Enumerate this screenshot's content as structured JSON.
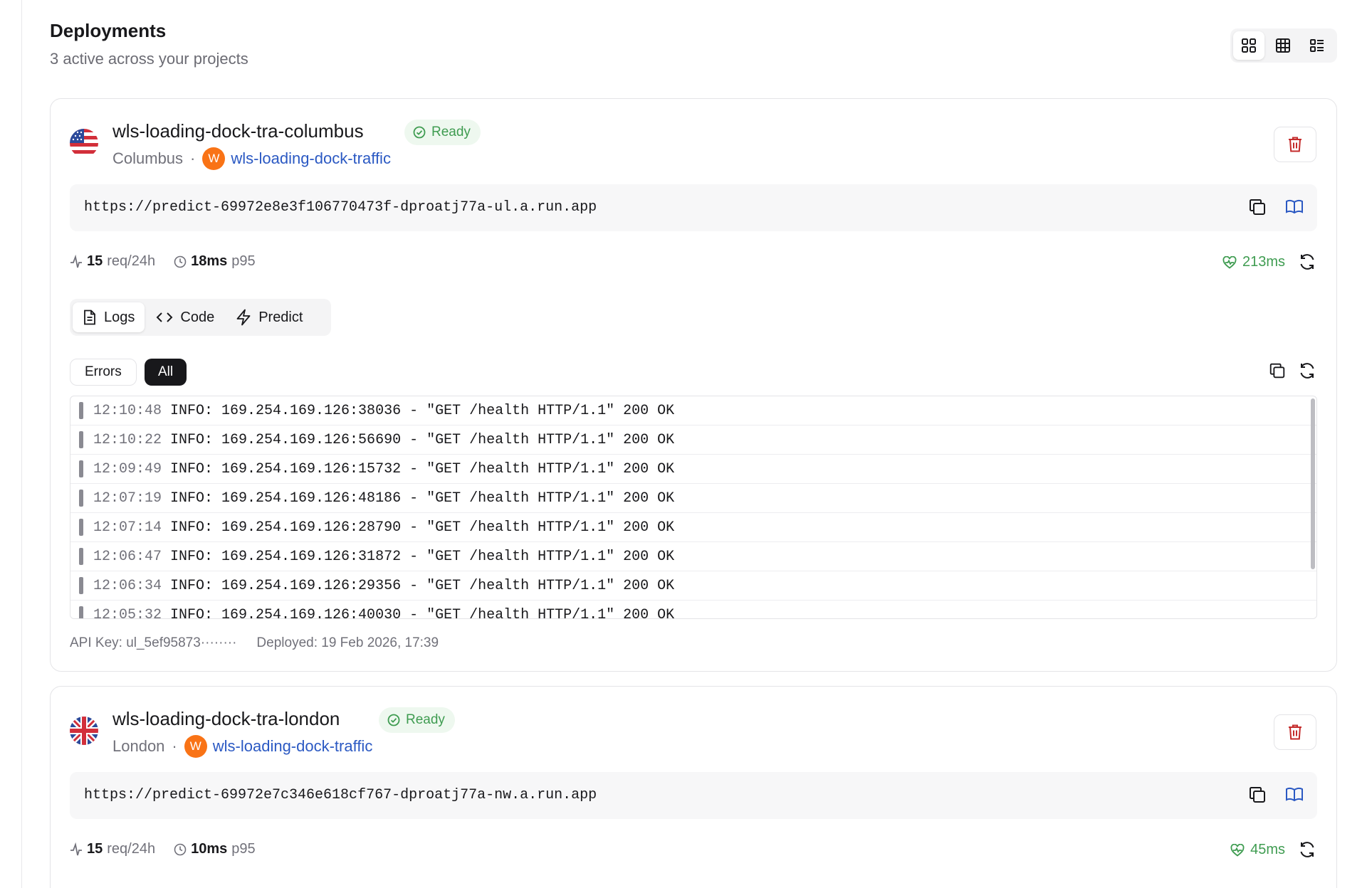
{
  "header": {
    "title": "Deployments",
    "subtitle": "3 active across your projects"
  },
  "view_modes": [
    {
      "icon": "grid-icon",
      "active": true
    },
    {
      "icon": "table-icon",
      "active": false
    },
    {
      "icon": "list-icon",
      "active": false
    }
  ],
  "deployments": [
    {
      "name": "wls-loading-dock-tra-columbus",
      "status": "Ready",
      "flag": "us-flag-icon",
      "location": "Columbus",
      "separator": "·",
      "project_initial": "W",
      "project": "wls-loading-dock-traffic",
      "url": "https://predict-69972e8e3f106770473f-dproatj77a-ul.a.run.app",
      "requests": "15",
      "requests_unit": "req/24h",
      "latency": "18ms",
      "latency_unit": "p95",
      "health": "213ms",
      "tabs": [
        {
          "label": "Logs",
          "icon": "document-icon",
          "active": true
        },
        {
          "label": "Code",
          "icon": "code-icon",
          "active": false
        },
        {
          "label": "Predict",
          "icon": "lightning-icon",
          "active": false
        }
      ],
      "filters": {
        "errors": "Errors",
        "all": "All",
        "selected": "All"
      },
      "logs": [
        {
          "time": "12:10:48",
          "text": "INFO: 169.254.169.126:38036 - \"GET /health HTTP/1.1\" 200 OK"
        },
        {
          "time": "12:10:22",
          "text": "INFO: 169.254.169.126:56690 - \"GET /health HTTP/1.1\" 200 OK"
        },
        {
          "time": "12:09:49",
          "text": "INFO: 169.254.169.126:15732 - \"GET /health HTTP/1.1\" 200 OK"
        },
        {
          "time": "12:07:19",
          "text": "INFO: 169.254.169.126:48186 - \"GET /health HTTP/1.1\" 200 OK"
        },
        {
          "time": "12:07:14",
          "text": "INFO: 169.254.169.126:28790 - \"GET /health HTTP/1.1\" 200 OK"
        },
        {
          "time": "12:06:47",
          "text": "INFO: 169.254.169.126:31872 - \"GET /health HTTP/1.1\" 200 OK"
        },
        {
          "time": "12:06:34",
          "text": "INFO: 169.254.169.126:29356 - \"GET /health HTTP/1.1\" 200 OK"
        },
        {
          "time": "12:05:32",
          "text": "INFO: 169.254.169.126:40030 - \"GET /health HTTP/1.1\" 200 OK"
        }
      ],
      "api_key": "API Key: ul_5ef95873········",
      "deployed": "Deployed: 19 Feb 2026, 17:39"
    },
    {
      "name": "wls-loading-dock-tra-london",
      "status": "Ready",
      "flag": "uk-flag-icon",
      "location": "London",
      "separator": "·",
      "project_initial": "W",
      "project": "wls-loading-dock-traffic",
      "url": "https://predict-69972e7c346e618cf767-dproatj77a-nw.a.run.app",
      "requests": "15",
      "requests_unit": "req/24h",
      "latency": "10ms",
      "latency_unit": "p95",
      "health": "45ms"
    }
  ],
  "colors": {
    "ready_green": "#3f9c51",
    "link_blue": "#2b59c3",
    "delete_red": "#c42b2b",
    "avatar_orange": "#f97316",
    "active_filter": "#18181b"
  }
}
